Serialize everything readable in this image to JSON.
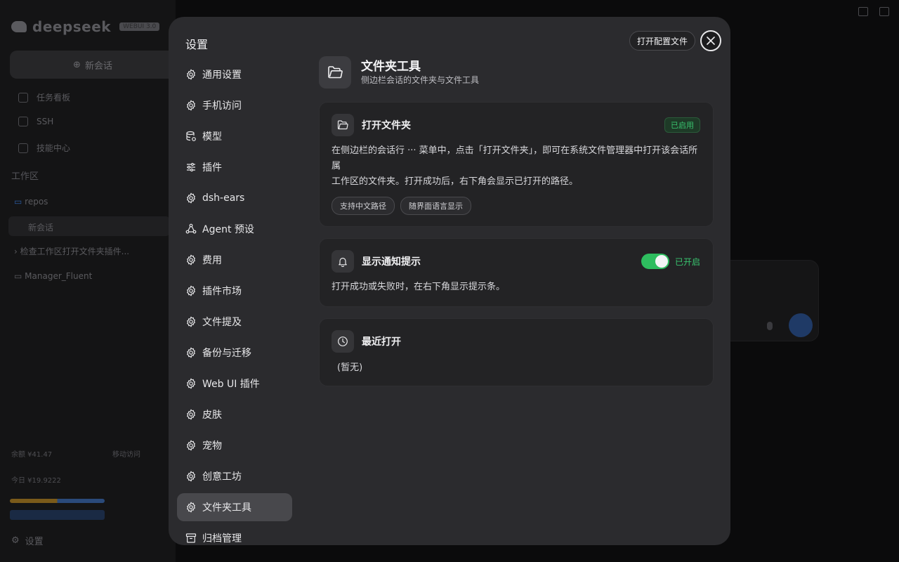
{
  "background": {
    "logo_text": "deepseek",
    "version_badge": "WEBUI 3.0",
    "new_chat_label": "新会话",
    "nav": [
      "任务看板",
      "SSH",
      "技能中心"
    ],
    "workspace_label": "工作区",
    "tree": [
      "repos",
      "新会话",
      "检查工作区打开文件夹插件...",
      "Manager_Fluent"
    ],
    "balance": "余额 ¥41.47",
    "today": "今日 ¥19.9222",
    "mobile_label": "移动访问",
    "settings_label": "设置"
  },
  "modal": {
    "title": "设置",
    "open_config_label": "打开配置文件",
    "nav": [
      {
        "label": "通用设置",
        "icon": "gear-icon"
      },
      {
        "label": "手机访问",
        "icon": "gear-icon"
      },
      {
        "label": "模型",
        "icon": "database-gear-icon"
      },
      {
        "label": "插件",
        "icon": "sliders-icon"
      },
      {
        "label": "dsh-ears",
        "icon": "gear-icon"
      },
      {
        "label": "Agent 预设",
        "icon": "nodes-icon"
      },
      {
        "label": "费用",
        "icon": "gear-icon"
      },
      {
        "label": "插件市场",
        "icon": "gear-icon"
      },
      {
        "label": "文件提及",
        "icon": "gear-icon"
      },
      {
        "label": "备份与迁移",
        "icon": "gear-icon"
      },
      {
        "label": "Web UI 插件",
        "icon": "gear-icon"
      },
      {
        "label": "皮肤",
        "icon": "gear-icon"
      },
      {
        "label": "宠物",
        "icon": "gear-icon"
      },
      {
        "label": "创意工坊",
        "icon": "gear-icon"
      },
      {
        "label": "文件夹工具",
        "icon": "gear-icon",
        "active": true
      },
      {
        "label": "归档管理",
        "icon": "archive-icon"
      }
    ],
    "content": {
      "title": "文件夹工具",
      "subtitle": "侧边栏会话的文件夹与文件工具",
      "cards": {
        "open_folder": {
          "title": "打开文件夹",
          "badge": "已启用",
          "desc_line1": "在侧边栏的会话行 ··· 菜单中，点击「打开文件夹」，即可在系统文件管理器中打开该会话所属",
          "desc_line2": "工作区的文件夹。打开成功后，右下角会显示已打开的路径。",
          "tags": [
            "支持中文路径",
            "随界面语言显示"
          ]
        },
        "notify": {
          "title": "显示通知提示",
          "toggle_label": "已开启",
          "toggle_on": true,
          "desc": "打开成功或失败时，在右下角显示提示条。"
        },
        "recent": {
          "title": "最近打开",
          "empty": "(暂无)"
        }
      }
    }
  },
  "colors": {
    "accent_green": "#2ebd5f",
    "modal_bg": "#2b2b2e",
    "card_bg": "#232325"
  }
}
